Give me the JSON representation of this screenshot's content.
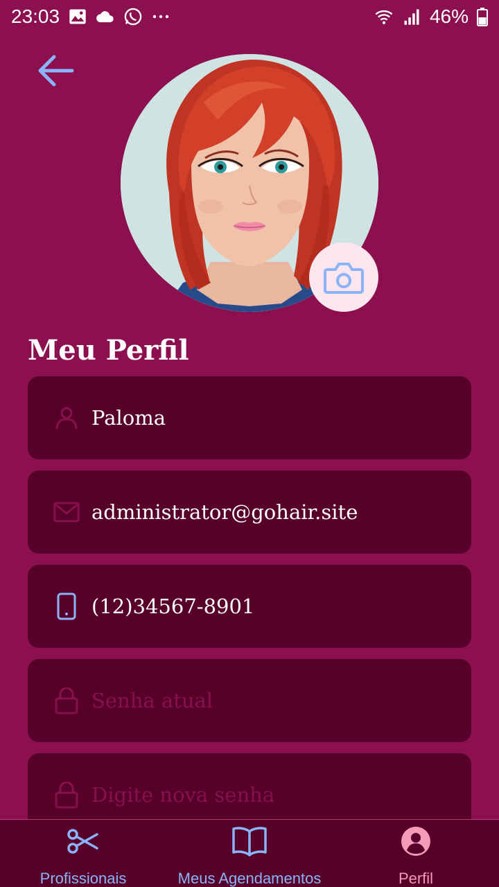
{
  "status_bar": {
    "time": "23:03",
    "battery": "46%",
    "icons": [
      "image-icon",
      "cloud-icon",
      "whatsapp-icon",
      "more-icon",
      "wifi-icon",
      "signal-icon",
      "battery-icon"
    ]
  },
  "header": {
    "back_icon": "arrow-left-icon"
  },
  "profile": {
    "title": "Meu Perfil",
    "camera_icon": "camera-icon"
  },
  "form": {
    "name_value": "Paloma",
    "email_value": "administrator@gohair.site",
    "phone_value": "(12)34567-8901",
    "current_password_placeholder": "Senha atual",
    "new_password_placeholder": "Digite nova senha"
  },
  "bottom_nav": {
    "items": [
      {
        "label": "Profissionais",
        "icon": "scissors-icon",
        "active": false
      },
      {
        "label": "Meus Agendamentos",
        "icon": "book-icon",
        "active": false
      },
      {
        "label": "Perfil",
        "icon": "user-circle-icon",
        "active": true
      }
    ]
  },
  "colors": {
    "background": "#8c1050",
    "field_background": "#57002a",
    "accent_blue": "#8ab4f8",
    "accent_pink": "#f59ab8"
  }
}
